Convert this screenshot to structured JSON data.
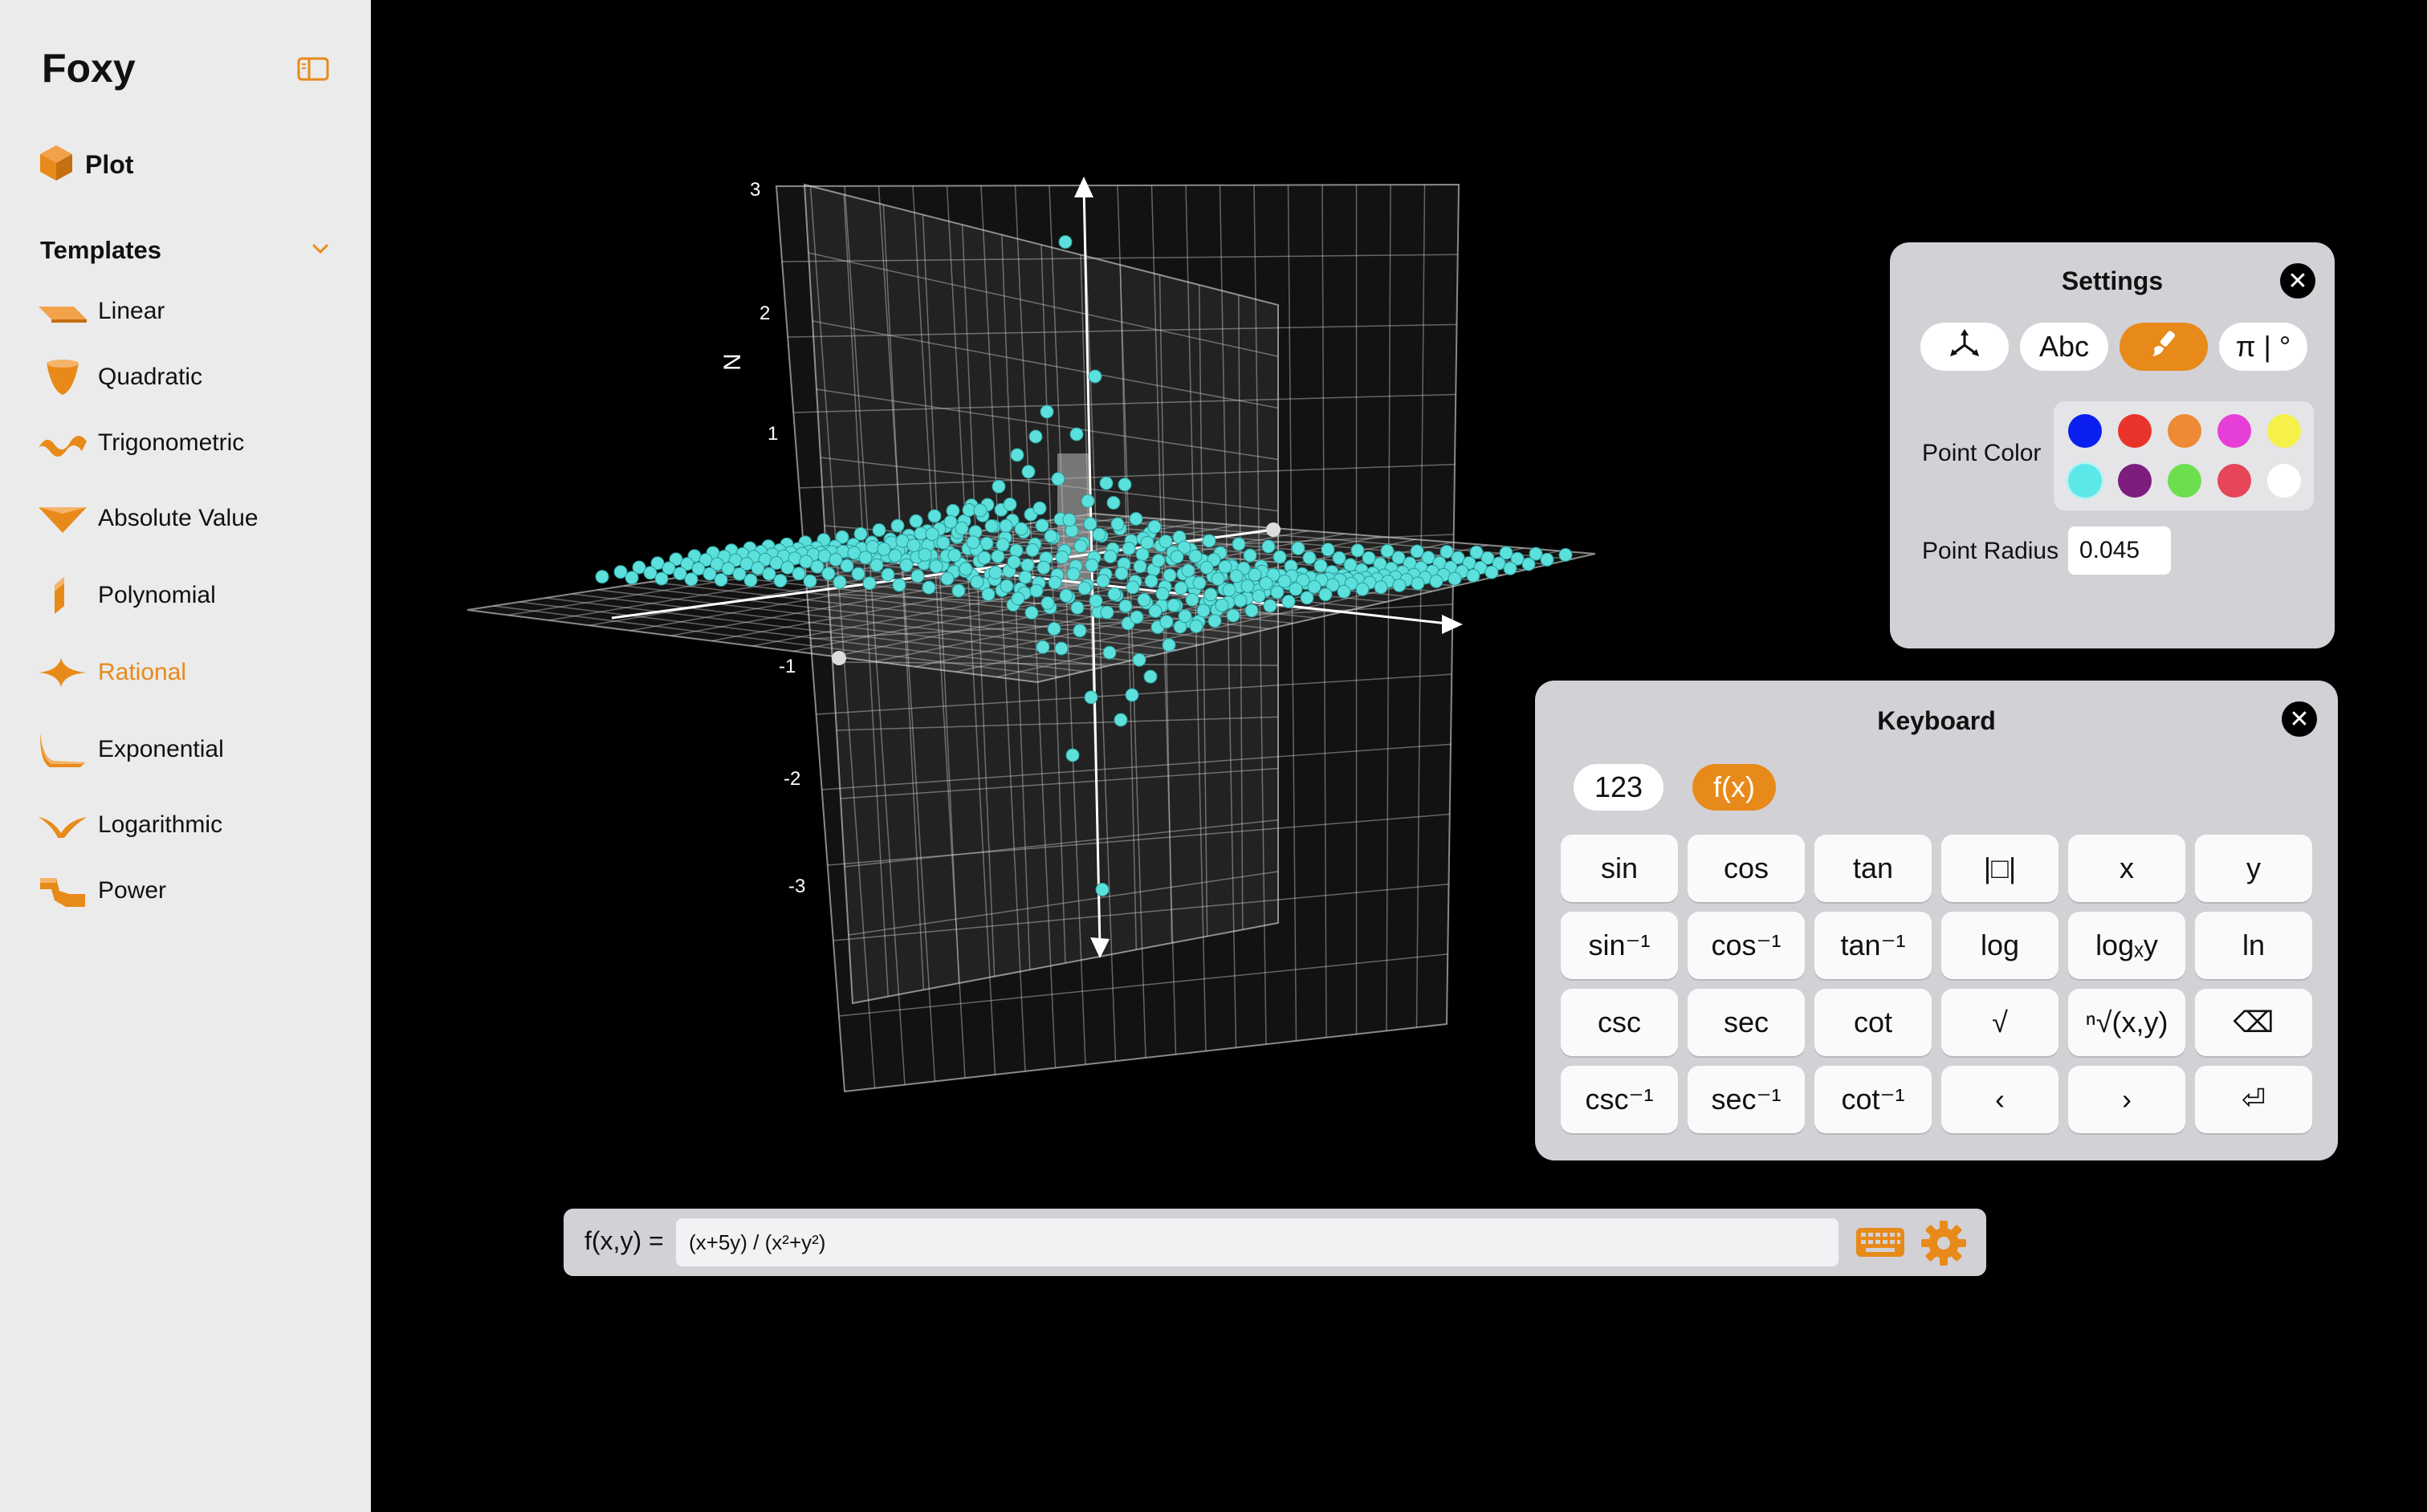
{
  "app": {
    "title": "Foxy"
  },
  "sidebar": {
    "plot_label": "Plot",
    "templates_label": "Templates",
    "templates": [
      {
        "label": "Linear",
        "icon": "linear-icon"
      },
      {
        "label": "Quadratic",
        "icon": "quadratic-icon"
      },
      {
        "label": "Trigonometric",
        "icon": "trigonometric-icon"
      },
      {
        "label": "Absolute Value",
        "icon": "absolute-value-icon"
      },
      {
        "label": "Polynomial",
        "icon": "polynomial-icon"
      },
      {
        "label": "Rational",
        "icon": "rational-icon",
        "selected": true
      },
      {
        "label": "Exponential",
        "icon": "exponential-icon"
      },
      {
        "label": "Logarithmic",
        "icon": "logarithmic-icon"
      },
      {
        "label": "Power",
        "icon": "power-icon"
      }
    ]
  },
  "plot": {
    "axis_letter": "N",
    "z_ticks": [
      "3",
      "2",
      "1",
      "-1",
      "-2",
      "-3"
    ],
    "point_color": "#5ce0dc"
  },
  "settings": {
    "title": "Settings",
    "close": "✕",
    "tabs": [
      {
        "label": "",
        "icon": "axes-icon"
      },
      {
        "label": "Abc",
        "icon": ""
      },
      {
        "label": "",
        "icon": "paintbrush-icon",
        "active": true
      },
      {
        "label": "π | °",
        "icon": ""
      }
    ],
    "point_color_label": "Point Color",
    "colors": [
      "#0a1ff0",
      "#e8342b",
      "#ee8a35",
      "#e63fd8",
      "#f5f04a",
      "#5ce8e8",
      "#7d1d7e",
      "#6ddf4f",
      "#e54658",
      "#ffffff"
    ],
    "point_radius_label": "Point Radius",
    "point_radius_value": "0.045"
  },
  "keyboard": {
    "title": "Keyboard",
    "close": "✕",
    "modes": [
      {
        "label": "123"
      },
      {
        "label": "f(x)",
        "active": true
      }
    ],
    "keys": [
      [
        "sin",
        "cos",
        "tan",
        "|□|",
        "x",
        "y"
      ],
      [
        "sin⁻¹",
        "cos⁻¹",
        "tan⁻¹",
        "log",
        "logₓy",
        "ln"
      ],
      [
        "csc",
        "sec",
        "cot",
        "√",
        "ⁿ√(x,y)",
        "⌫"
      ],
      [
        "csc⁻¹",
        "sec⁻¹",
        "cot⁻¹",
        "‹",
        "›",
        "⏎"
      ]
    ]
  },
  "formula": {
    "label": "f(x,y) =",
    "value": "(x+5y) / (x²+y²)"
  }
}
